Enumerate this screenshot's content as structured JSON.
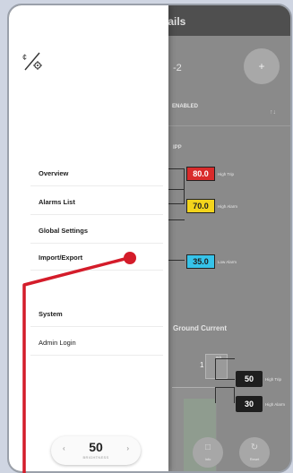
{
  "header": {
    "title": "Circuit Details"
  },
  "circuit": {
    "id_fragment": "-2",
    "plus_label": "+",
    "enabled_label": "ENABLED",
    "corner_mark": "↑↓"
  },
  "panel": {
    "label": "IPP",
    "thresholds": [
      {
        "value": "80.0",
        "label": "High Trip",
        "color": "#d92b2b",
        "text_color": "#ffffff"
      },
      {
        "value": "70.0",
        "label": "High Alarm",
        "color": "#f3d41c",
        "text_color": "#202020"
      },
      {
        "value": "35.0",
        "label": "Low Alarm",
        "color": "#36c3e9",
        "text_color": "#202020"
      }
    ]
  },
  "ground_current": {
    "title": "Ground Current",
    "unit": "mA",
    "value": "1",
    "trips": [
      {
        "value": "50",
        "label": "High Trip"
      },
      {
        "value": "30",
        "label": "High Alarm"
      }
    ]
  },
  "bottom_buttons": [
    {
      "glyph": "□",
      "label": "Info"
    },
    {
      "glyph": "↻",
      "label": "Reset"
    }
  ],
  "drawer": {
    "logo_text": "¢/⚙",
    "items": [
      {
        "label": "Overview"
      },
      {
        "label": "Alarms List"
      },
      {
        "label": "Global Settings"
      },
      {
        "label": "Import/Export"
      },
      {
        "label": "System"
      },
      {
        "label": "Admin Login"
      }
    ],
    "brightness": {
      "value": "50",
      "caption": "BRIGHTNESS",
      "left_arrow": "‹",
      "right_arrow": "›"
    }
  },
  "pointer": {
    "color": "#d41c2a"
  }
}
